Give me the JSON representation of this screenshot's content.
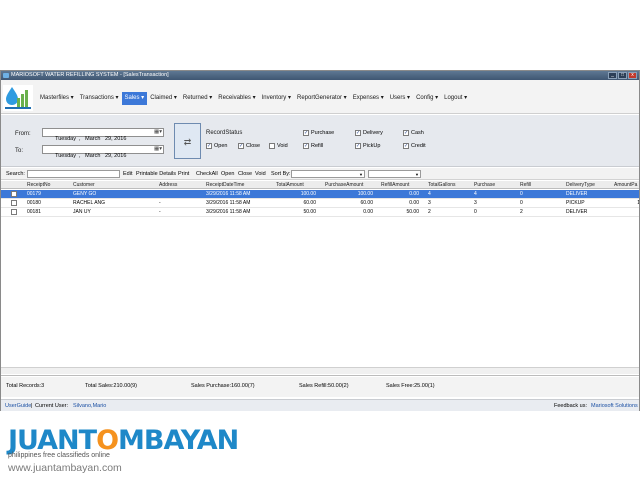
{
  "window": {
    "title": "MARIOSOFT WATER REFILLING SYSTEM - [SalesTransaction]",
    "controls": [
      "_",
      "□",
      "x"
    ]
  },
  "menu": [
    {
      "label": "Masterfiles ▾",
      "active": false
    },
    {
      "label": "Transactions ▾",
      "active": false
    },
    {
      "label": "Sales ▾",
      "active": true
    },
    {
      "label": "Claimed ▾",
      "active": false
    },
    {
      "label": "Returned ▾",
      "active": false
    },
    {
      "label": "Receivables ▾",
      "active": false
    },
    {
      "label": "Inventory ▾",
      "active": false
    },
    {
      "label": "ReportGenerator ▾",
      "active": false
    },
    {
      "label": "Expenses ▾",
      "active": false
    },
    {
      "label": "Users ▾",
      "active": false
    },
    {
      "label": "Config ▾",
      "active": false
    },
    {
      "label": "Logout ▾",
      "active": false
    }
  ],
  "filters": {
    "from_label": "From:",
    "to_label": "To:",
    "from_date": "Tuesday  ,   March   29, 2016",
    "to_date": "Tuesday  ,   March   29, 2016",
    "go_icon": "go-icon",
    "record_status_label": "RecordStatus",
    "open": {
      "label": "Open",
      "checked": true
    },
    "close": {
      "label": "Close",
      "checked": true
    },
    "void": {
      "label": "Void",
      "checked": false
    },
    "purchase": {
      "label": "Purchase",
      "checked": true
    },
    "refill": {
      "label": "Refill",
      "checked": true
    },
    "delivery": {
      "label": "Delivery",
      "checked": true
    },
    "pickup": {
      "label": "PickUp",
      "checked": true
    },
    "cash": {
      "label": "Cash",
      "checked": true
    },
    "credit": {
      "label": "Credit",
      "checked": true
    }
  },
  "toolbar": {
    "search_label": "Search:",
    "edit": "Edit",
    "printable_details": "Printable Details",
    "print": "Print",
    "check_all": "CheckAll",
    "open": "Open",
    "close": "Close",
    "void": "Void",
    "sort_by": "Sort By:"
  },
  "grid": {
    "columns": [
      "ReceiptNo",
      "Customer",
      "Address",
      "ReceiptDateTime",
      "TotalAmount",
      "PurchaseAmount",
      "RefillAmount",
      "TotalGallons",
      "Purchase",
      "Refill",
      "DeliveryType",
      "AmountPa"
    ],
    "rows": [
      {
        "selected": true,
        "cells": [
          "00179",
          "GENY GO",
          "",
          "3/29/2016 11:58 AM",
          "100.00",
          "100.00",
          "0.00",
          "4",
          "4",
          "0",
          "DELIVER",
          ""
        ]
      },
      {
        "selected": false,
        "cells": [
          "00180",
          "RACHEL ANG",
          "-",
          "3/29/2016 11:58 AM",
          "60.00",
          "60.00",
          "0.00",
          "3",
          "3",
          "0",
          "PICKUP",
          "1"
        ]
      },
      {
        "selected": false,
        "cells": [
          "00181",
          "JAN UY",
          "-",
          "3/29/2016 11:58 AM",
          "50.00",
          "0.00",
          "50.00",
          "2",
          "0",
          "2",
          "DELIVER",
          ""
        ]
      }
    ]
  },
  "footer": {
    "total_records": "Total Records:3",
    "total_sales": "Total Sales:210.00(9)",
    "sales_purchase": "Sales Purchase:160.00(7)",
    "sales_refill": "Sales Refill:50.00(2)",
    "sales_free": "Sales Free:25.00(1)"
  },
  "status": {
    "userguide": "UserGuide",
    "current_user_label": "Current User:",
    "current_user": "Silvano,Mario",
    "feedback_label": "Feedback us:",
    "feedback_link": "Mariosoft Solutions"
  },
  "watermark": {
    "logo_text_1": "JUANT",
    "logo_text_2": "O",
    "logo_text_3": "MBAYAN",
    "tagline": "philippines  free classifieds online",
    "url": "www.juantambayan.com"
  }
}
